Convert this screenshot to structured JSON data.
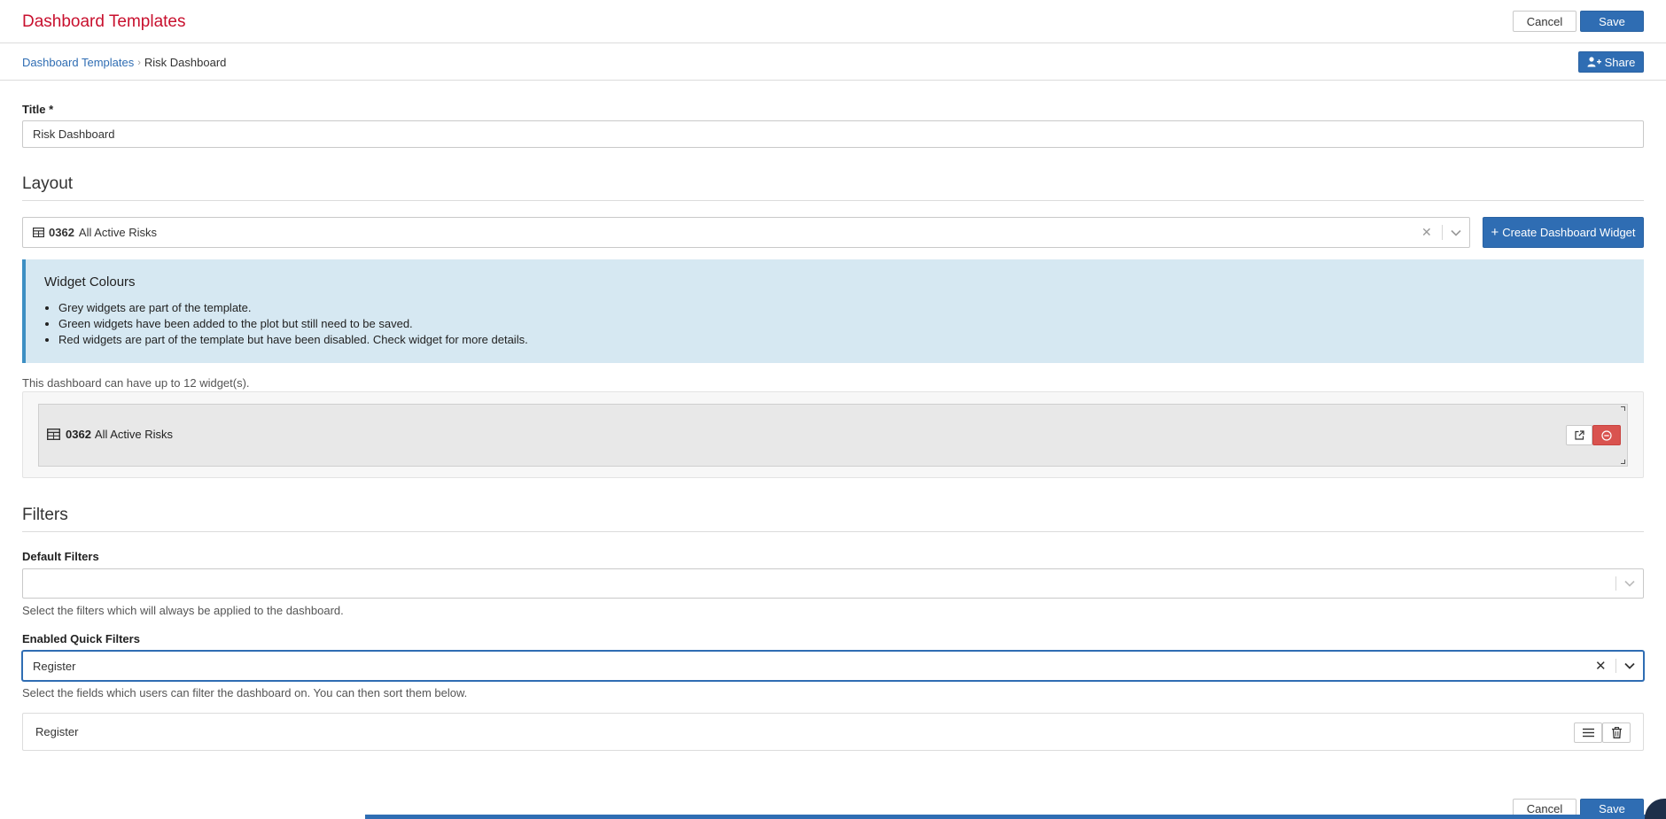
{
  "header": {
    "title": "Dashboard Templates",
    "cancel_label": "Cancel",
    "save_label": "Save"
  },
  "breadcrumb": {
    "parent": "Dashboard Templates",
    "separator": "›",
    "current": "Risk Dashboard",
    "share_label": "Share"
  },
  "form": {
    "title_label": "Title *",
    "title_value": "Risk Dashboard"
  },
  "layout": {
    "heading": "Layout",
    "selected_widget_code": "0362",
    "selected_widget_name": "All Active Risks",
    "create_button_label": "Create Dashboard Widget"
  },
  "alert": {
    "title": "Widget Colours",
    "items": [
      "Grey widgets are part of the template.",
      "Green widgets have been added to the plot but still need to be saved.",
      "Red widgets are part of the template but have been disabled. Check widget for more details."
    ]
  },
  "widgets": {
    "limit_text": "This dashboard can have up to 12 widget(s).",
    "items": [
      {
        "code": "0362",
        "name": "All Active Risks"
      }
    ]
  },
  "filters": {
    "heading": "Filters",
    "default_label": "Default Filters",
    "default_value": "",
    "default_help": "Select the filters which will always be applied to the dashboard.",
    "quick_label": "Enabled Quick Filters",
    "quick_value": "Register",
    "quick_help": "Select the fields which users can filter the dashboard on. You can then sort them below.",
    "quick_items": [
      "Register"
    ]
  },
  "footer": {
    "cancel_label": "Cancel",
    "save_label": "Save"
  },
  "colors": {
    "brand_red": "#c8102e",
    "primary_blue": "#2f6db3",
    "danger_red": "#d9534f",
    "alert_bg": "#d6e8f2",
    "widget_grey": "#e8e8e8"
  }
}
